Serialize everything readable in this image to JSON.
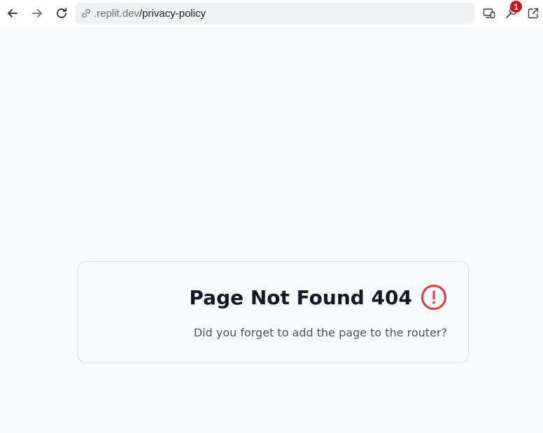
{
  "browser": {
    "url_domain": ".replit.dev",
    "url_path": "/privacy-policy",
    "notification_count": "1"
  },
  "icons": {
    "back": "arrow-left-icon",
    "forward": "arrow-right-icon",
    "reload": "reload-icon",
    "link": "link-icon",
    "devices": "devices-icon",
    "tools": "wrench-icon",
    "open_external": "open-external-icon",
    "alert": "alert-circle-icon"
  },
  "colors": {
    "page_background": "#f8f9fb",
    "alert_icon": "#e0383c",
    "badge": "#c8161d",
    "title": "#121826",
    "message": "#4b5160"
  },
  "error_card": {
    "title": "Page Not Found 404",
    "message": "?Did you forget to add the page to the router"
  }
}
